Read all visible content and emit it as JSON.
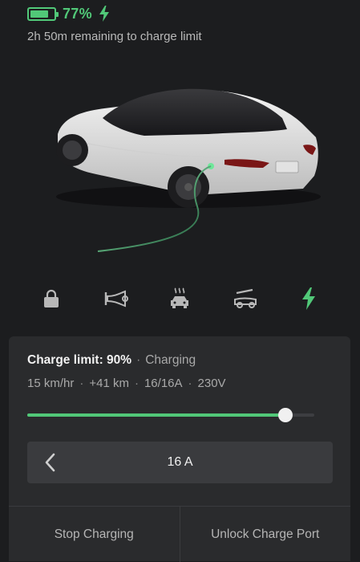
{
  "status": {
    "battery_percent_text": "77%",
    "battery_level": 0.77,
    "remaining_text": "2h 50m remaining to charge limit"
  },
  "controls": [
    {
      "name": "lock",
      "icon": "lock-icon"
    },
    {
      "name": "horn",
      "icon": "horn-icon"
    },
    {
      "name": "climate",
      "icon": "climate-icon"
    },
    {
      "name": "trunk",
      "icon": "trunk-icon"
    },
    {
      "name": "charge",
      "icon": "charging-bolt-icon"
    }
  ],
  "charge": {
    "limit_text": "Charge limit: 90%",
    "state_text": "Charging",
    "rate_text": "15 km/hr",
    "added_text": "+41 km",
    "current_text": "16/16A",
    "voltage_text": "230V",
    "limit_level": 0.9
  },
  "amps": {
    "value": "16 A"
  },
  "actions": {
    "stop_label": "Stop Charging",
    "unlock_label": "Unlock Charge Port"
  },
  "colors": {
    "accent": "#51c878",
    "background": "#1c1d1f",
    "panel": "#2a2b2d"
  }
}
